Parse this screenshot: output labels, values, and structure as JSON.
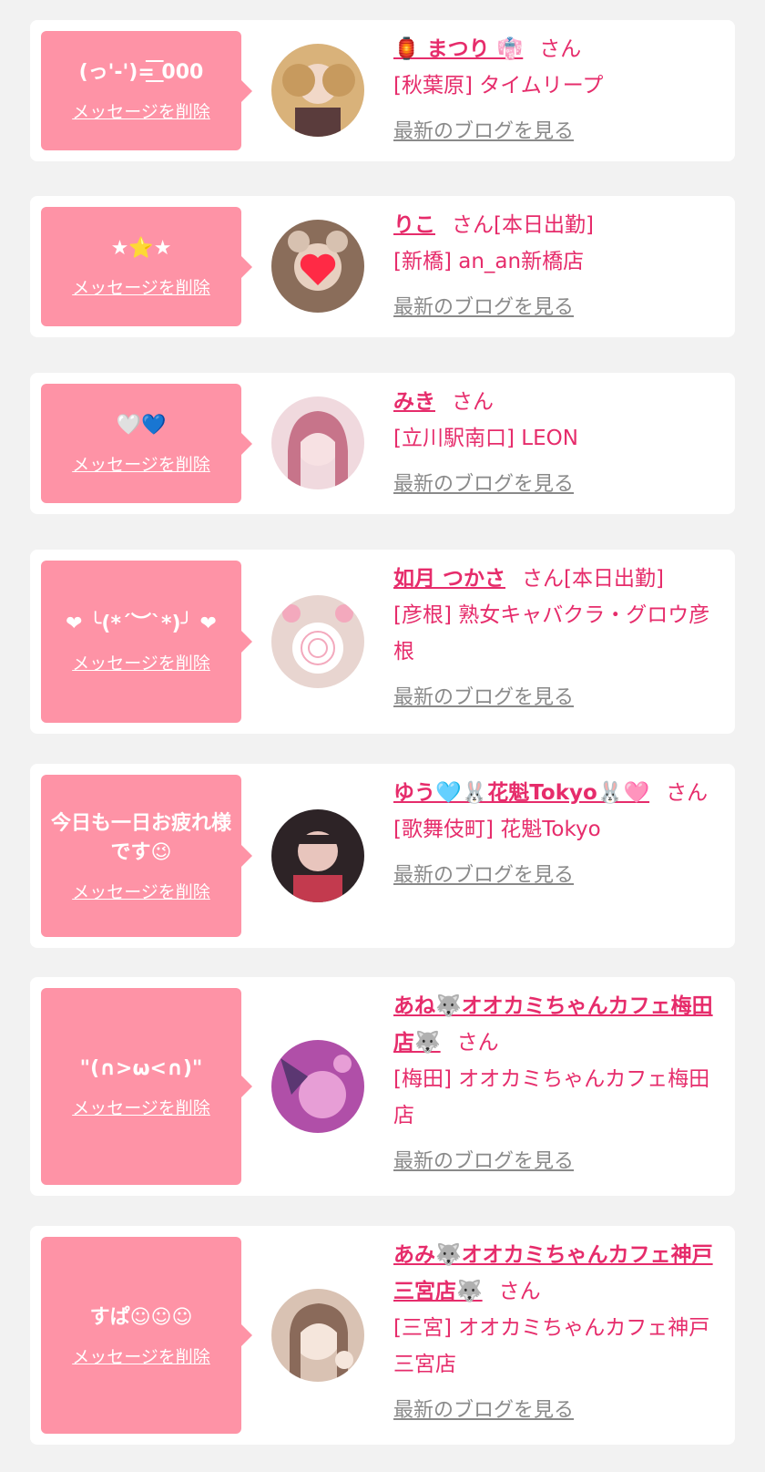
{
  "colors": {
    "background": "#f2f2f2",
    "card": "#ffffff",
    "bubble": "#fe93a6",
    "accent": "#e62c6b",
    "link_gray": "#8a8a8a"
  },
  "cards": [
    {
      "message": "(っ'-')=͟͟͞͞ 000",
      "delete_label": "メッセージを削除",
      "name": "🏮 まつり 👘",
      "honorific": "さん",
      "status": "",
      "shop": "[秋葉原] タイムリープ",
      "blog_label": "最新のブログを見る",
      "avatar_colors": [
        "#d9b27a",
        "#5a3c3c",
        "#a25566"
      ]
    },
    {
      "message": "★⭐★",
      "delete_label": "メッセージを削除",
      "name": "りこ",
      "honorific": "さん",
      "status": "[本日出勤]",
      "shop": "[新橋] an_an新橋店",
      "blog_label": "最新のブログを見る",
      "avatar_colors": [
        "#8a6d5a",
        "#d7c1b0",
        "#ff2a45"
      ]
    },
    {
      "message": "🤍💙",
      "delete_label": "メッセージを削除",
      "name": "みき",
      "honorific": "さん",
      "status": "",
      "shop": "[立川駅南口] LEON",
      "blog_label": "最新のブログを見る",
      "avatar_colors": [
        "#c7748a",
        "#f0d9de",
        "#9a5d78"
      ]
    },
    {
      "message": "❤ ╰(*´︶`*)╯ ❤",
      "delete_label": "メッセージを削除",
      "name": "如月 つかさ",
      "honorific": "さん",
      "status": "[本日出勤]",
      "shop": "[彦根] 熟女キャバクラ・グロウ彦根",
      "blog_label": "最新のブログを見る",
      "avatar_colors": [
        "#e8d5d0",
        "#ffffff",
        "#f3a9bd"
      ]
    },
    {
      "message": "今日も一日お疲れ様です😉",
      "delete_label": "メッセージを削除",
      "name": "ゆう🩵🐰花魁Tokyo🐰🩷",
      "honorific": "さん",
      "status": "",
      "shop": "[歌舞伎町] 花魁Tokyo",
      "blog_label": "最新のブログを見る",
      "avatar_colors": [
        "#2d2326",
        "#e8c5bd",
        "#c33a4e"
      ]
    },
    {
      "message": "\"(∩>ω<∩)\"",
      "delete_label": "メッセージを削除",
      "name": "あね🐺オオカミちゃんカフェ梅田店🐺",
      "honorific": "さん",
      "status": "",
      "shop": "[梅田] オオカミちゃんカフェ梅田店",
      "blog_label": "最新のブログを見る",
      "avatar_colors": [
        "#b04fa8",
        "#e79ed6",
        "#5b3772"
      ]
    },
    {
      "message": "すぱ☺☺☺",
      "delete_label": "メッセージを削除",
      "name": "あみ🐺オオカミちゃんカフェ神戸三宮店🐺",
      "honorific": "さん",
      "status": "",
      "shop": "[三宮] オオカミちゃんカフェ神戸三宮店",
      "blog_label": "最新のブログを見る",
      "avatar_colors": [
        "#d9c2b3",
        "#f5e6dc",
        "#8a6a5a"
      ]
    }
  ]
}
